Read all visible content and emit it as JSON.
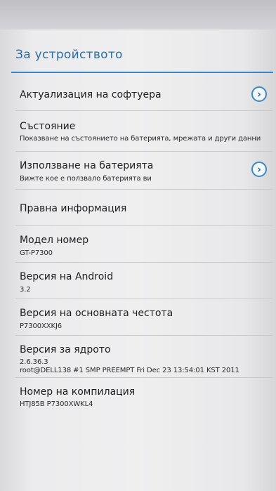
{
  "header": {
    "title": "За устройството"
  },
  "items": [
    {
      "label": "Актуализация на софтуера"
    },
    {
      "label": "Състояние",
      "summary": "Показване на състоянието на батерията, мрежата и други данни"
    },
    {
      "label": "Използване на батерията",
      "summary": "Вижте кое е ползвало батерията ви"
    },
    {
      "label": "Правна информация"
    },
    {
      "label": "Модел номер",
      "summary": "GT-P7300"
    },
    {
      "label": "Версия на Android",
      "summary": "3.2"
    },
    {
      "label": "Версия на основната честота",
      "summary": "P7300XXKJ6"
    },
    {
      "label": "Версия за ядрото",
      "summary": "2.6.36.3",
      "summary2": "root@DELL138 #1 SMP PREEMPT Fri Dec 23 13:54:01 KST 2011"
    },
    {
      "label": "Номер на компилация",
      "summary": "HTJ85B P7300XWKL4"
    }
  ],
  "icons": {
    "chevron": "›"
  },
  "colors": {
    "accent": "#3a86c2",
    "title": "#2f6c9e"
  }
}
